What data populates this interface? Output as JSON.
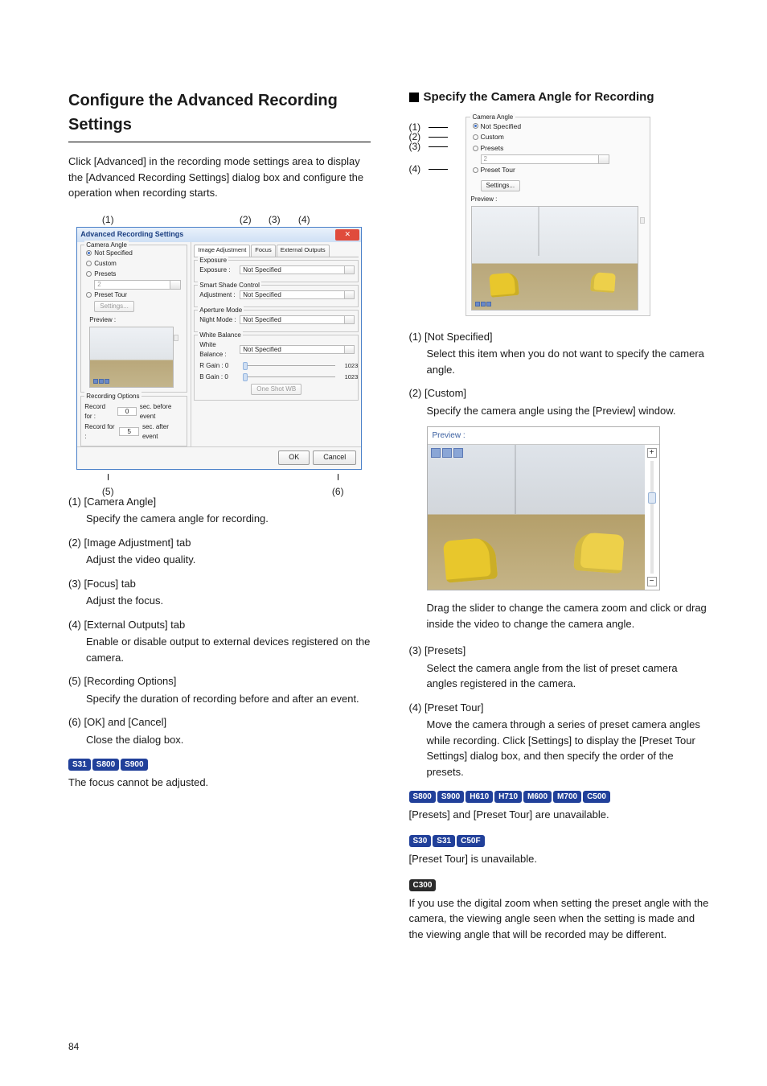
{
  "page_number": "84",
  "left": {
    "title": "Configure the Advanced Recording Settings",
    "intro": "Click [Advanced] in the recording mode settings area to display the [Advanced Recording Settings] dialog box and configure the operation when recording starts.",
    "callouts_top": {
      "c1": "(1)",
      "c2": "(2)",
      "c3": "(3)",
      "c4": "(4)"
    },
    "callouts_bot": {
      "c5": "(5)",
      "c6": "(6)"
    },
    "dialog": {
      "title": "Advanced Recording Settings",
      "camera_angle_label": "Camera Angle",
      "opt_not_specified": "Not Specified",
      "opt_custom": "Custom",
      "opt_presets": "Presets",
      "preset_value": "2",
      "opt_preset_tour": "Preset Tour",
      "settings_btn": "Settings...",
      "preview_label": "Preview :",
      "rec_opts_label": "Recording Options",
      "rec_for": "Record for :",
      "rec_before_val": "0",
      "rec_before_unit": "sec. before event",
      "rec_after_val": "5",
      "rec_after_unit": "sec. after event",
      "tabs": {
        "img": "Image Adjustment",
        "focus": "Focus",
        "ext": "External Outputs"
      },
      "grp_exposure": "Exposure",
      "exposure_lbl": "Exposure :",
      "exposure_val": "Not Specified",
      "grp_shade": "Smart Shade Control",
      "shade_lbl": "Adjustment :",
      "shade_val": "Not Specified",
      "grp_aperture": "Aperture Mode",
      "night_lbl": "Night Mode :",
      "night_val": "Not Specified",
      "grp_wb": "White Balance",
      "wb_lbl": "White Balance :",
      "wb_val": "Not Specified",
      "rgain": "R Gain :   0",
      "bgain": "B Gain :   0",
      "gain_max": "1023",
      "oneshot": "One Shot WB",
      "ok": "OK",
      "cancel": "Cancel"
    },
    "items": [
      {
        "head": "(1) [Camera Angle]",
        "body": "Specify the camera angle for recording."
      },
      {
        "head": "(2) [Image Adjustment] tab",
        "body": "Adjust the video quality."
      },
      {
        "head": "(3) [Focus] tab",
        "body": "Adjust the focus."
      },
      {
        "head": "(4) [External Outputs] tab",
        "body": "Enable or disable output to external devices registered on the camera."
      },
      {
        "head": "(5) [Recording Options]",
        "body": "Specify the duration of recording before and after an event."
      },
      {
        "head": "(6) [OK] and [Cancel]",
        "body": "Close the dialog box."
      }
    ],
    "tags1": [
      "S31",
      "S800",
      "S900"
    ],
    "tags1_note": "The focus cannot be adjusted."
  },
  "right": {
    "title": "Specify the Camera Angle for Recording",
    "ca_labels": {
      "l1": "(1)",
      "l2": "(2)",
      "l3": "(3)",
      "l4": "(4)"
    },
    "panel": {
      "label": "Camera Angle",
      "not_specified": "Not Specified",
      "custom": "Custom",
      "presets": "Presets",
      "preset_value": "2",
      "preset_tour": "Preset Tour",
      "settings": "Settings...",
      "preview": "Preview :"
    },
    "items": [
      {
        "head": "(1) [Not Specified]",
        "body": "Select this item when you do not want to specify the camera angle."
      },
      {
        "head": "(2) [Custom]",
        "body": "Specify the camera angle using the [Preview] window."
      }
    ],
    "preview_label": "Preview :",
    "custom_note": "Drag the slider to change the camera zoom and click or drag inside the video to change the camera angle.",
    "items2": [
      {
        "head": "(3) [Presets]",
        "body": "Select the camera angle from the list of preset camera angles registered in the camera."
      },
      {
        "head": "(4) [Preset Tour]",
        "body": "Move the camera through a series of preset camera angles while recording. Click [Settings] to display the [Preset Tour Settings] dialog box, and then specify the order of the presets."
      }
    ],
    "tagsA": [
      "S800",
      "S900",
      "H610",
      "H710",
      "M600",
      "M700",
      "C500"
    ],
    "tagsA_note": "[Presets] and [Preset Tour] are unavailable.",
    "tagsB": [
      "S30",
      "S31",
      "C50F"
    ],
    "tagsB_note": "[Preset Tour] is unavailable.",
    "tagsC": [
      "C300"
    ],
    "tagsC_note": "If you use the digital zoom when setting the preset angle with the camera, the viewing angle seen when the setting is made and the viewing angle that will be recorded may be different."
  }
}
